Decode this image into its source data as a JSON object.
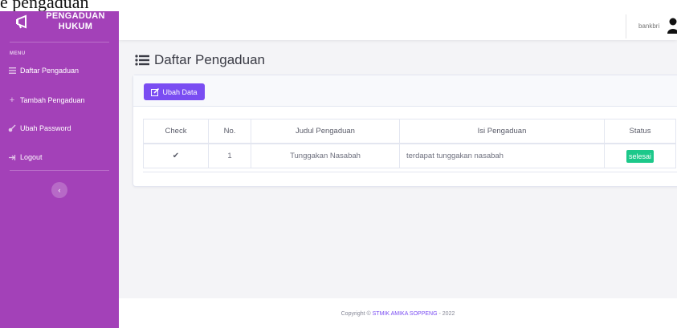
{
  "top_clip_text": "e pengaduan",
  "sidebar": {
    "brand_line1": "PENGADUAN",
    "brand_line2": "HUKUM",
    "menu_heading": "MENU",
    "items": [
      {
        "label": "Daftar Pengaduan",
        "icon": "list-icon"
      },
      {
        "label": "Tambah Pengaduan",
        "icon": "plus-icon"
      },
      {
        "label": "Ubah Password",
        "icon": "key-icon"
      },
      {
        "label": "Logout",
        "icon": "logout-icon"
      }
    ],
    "toggle_glyph": "‹"
  },
  "topbar": {
    "username": "bankbri"
  },
  "page": {
    "title": "Daftar Pengaduan"
  },
  "card": {
    "edit_button": "Ubah Data",
    "columns": [
      "Check",
      "No.",
      "Judul Pengaduan",
      "Isi Pengaduan",
      "Status"
    ],
    "rows": [
      {
        "check": "✔",
        "no": "1",
        "judul": "Tunggakan Nasabah",
        "isi": "terdapat tunggakan nasabah",
        "status": "selesai"
      }
    ]
  },
  "footer": {
    "prefix": "Copyright © ",
    "link": "STMIK AMIKA SOPPENG",
    "suffix": " - 2022"
  },
  "colors": {
    "sidebar": "#a341b8",
    "accent": "#7a4df2",
    "status_done": "#1cc88a"
  }
}
